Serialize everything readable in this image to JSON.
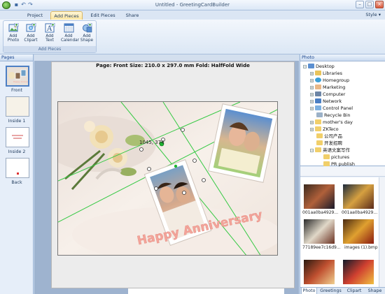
{
  "window": {
    "title": "Untitled - GreetingCardBuilder",
    "controls": [
      "minimize-icon",
      "maximize-icon",
      "close-icon"
    ]
  },
  "quick_access": [
    "save-icon",
    "undo-icon",
    "redo-icon"
  ],
  "menu_tabs": [
    {
      "label": "Project",
      "active": false
    },
    {
      "label": "Add Pieces",
      "active": true
    },
    {
      "label": "Edit Pieces",
      "active": false
    },
    {
      "label": "Share",
      "active": false
    }
  ],
  "style_menu": "Style ▾",
  "ribbon": {
    "group_label": "Add Pieces",
    "buttons": [
      {
        "label1": "Add",
        "label2": "Photo",
        "icon": "photo-icon"
      },
      {
        "label1": "Add",
        "label2": "Clipart",
        "icon": "clipart-icon"
      },
      {
        "label1": "Add",
        "label2": "Text",
        "icon": "text-icon"
      },
      {
        "label1": "Add",
        "label2": "Calendar",
        "icon": "calendar-icon"
      },
      {
        "label1": "Add",
        "label2": "Shape",
        "icon": "shape-icon"
      }
    ]
  },
  "pages_panel": {
    "title": "Pages",
    "pages": [
      "Front",
      "Inside 1",
      "Inside 2",
      "Back"
    ],
    "selected": "Front"
  },
  "canvas": {
    "page_info": "Page: Front   Size: 210.0 x 297.0 mm   Fold: HalfFold Wide",
    "coordinates": "1045, 374",
    "card_text": "Happy Anniversary"
  },
  "photo_panel": {
    "title": "Photo",
    "tree": [
      {
        "label": "Desktop",
        "level": 0,
        "expander": "−",
        "icon": "desktop"
      },
      {
        "label": "Libraries",
        "level": 1,
        "expander": "+",
        "icon": "library"
      },
      {
        "label": "Homegroup",
        "level": 1,
        "expander": "+",
        "icon": "homegroup"
      },
      {
        "label": "Marketing",
        "level": 1,
        "expander": "+",
        "icon": "user"
      },
      {
        "label": "Computer",
        "level": 1,
        "expander": "+",
        "icon": "computer"
      },
      {
        "label": "Network",
        "level": 1,
        "expander": "+",
        "icon": "network"
      },
      {
        "label": "Control Panel",
        "level": 1,
        "expander": "+",
        "icon": "control"
      },
      {
        "label": "Recycle Bin",
        "level": 1,
        "expander": "",
        "icon": "recycle"
      },
      {
        "label": "mother's day",
        "level": 1,
        "expander": "+",
        "icon": "folder"
      },
      {
        "label": "ZKTeco",
        "level": 1,
        "expander": "+",
        "icon": "folder"
      },
      {
        "label": "公司产品",
        "level": 1,
        "expander": "",
        "icon": "folder"
      },
      {
        "label": "开发招聘",
        "level": 1,
        "expander": "",
        "icon": "folder"
      },
      {
        "label": "英语文案写作",
        "level": 1,
        "expander": "−",
        "icon": "folder"
      },
      {
        "label": "pictures",
        "level": 2,
        "expander": "",
        "icon": "folder"
      },
      {
        "label": "PR publish",
        "level": 2,
        "expander": "",
        "icon": "folder"
      }
    ],
    "thumbnails": [
      {
        "label": "001aa0ba4929...",
        "colors": [
          "#3a2a1e",
          "#b0603a",
          "#1a1a2a"
        ]
      },
      {
        "label": "001aa0ba4929...",
        "colors": [
          "#1c2a3c",
          "#d6a040",
          "#5a2a1a"
        ]
      },
      {
        "label": "77189ee7c16d9...",
        "colors": [
          "#2a2a2a",
          "#e0d8c8",
          "#6a3020"
        ]
      },
      {
        "label": "images (1).bmp",
        "colors": [
          "#4a2a10",
          "#e0a030",
          "#8a1a10"
        ]
      },
      {
        "label": "",
        "colors": [
          "#2a1a10",
          "#c05030",
          "#f0d090"
        ]
      },
      {
        "label": "",
        "colors": [
          "#101a2a",
          "#d04030",
          "#f0c040"
        ]
      }
    ],
    "tabs": [
      "Photo",
      "Greetings",
      "Clipart",
      "Shape"
    ],
    "active_tab": "Photo"
  },
  "colors": {
    "ribbon_active_tab": "#ffe7a0",
    "frame_blue": "#c5d7ee",
    "guide_green": "#35c943",
    "handle_green": "#1db531",
    "anniversary_text": "#f3a49a"
  }
}
